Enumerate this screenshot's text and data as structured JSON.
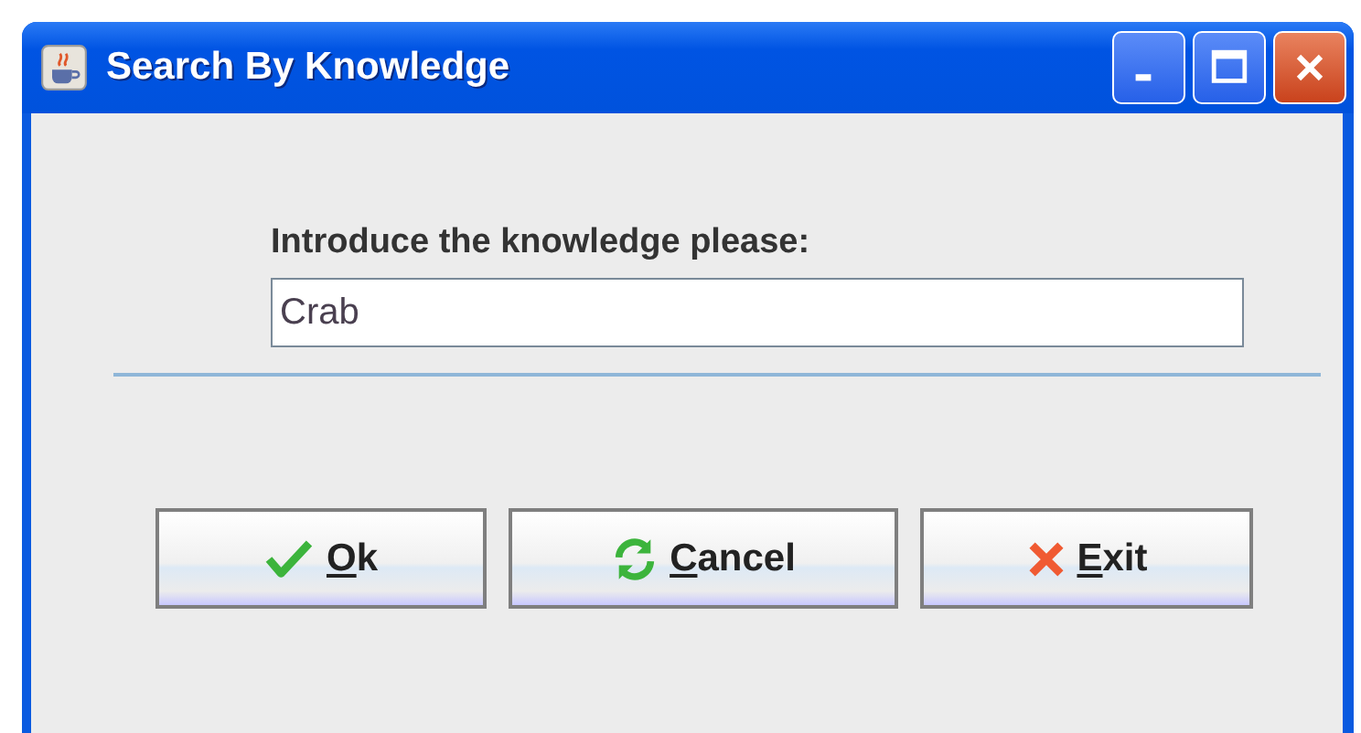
{
  "window": {
    "title": "Search By Knowledge"
  },
  "prompt": "Introduce the knowledge please:",
  "field": {
    "value": "Crab"
  },
  "buttons": [
    {
      "kind": "ok",
      "label": "Ok"
    },
    {
      "kind": "cancel",
      "label": "Cancel"
    },
    {
      "kind": "exit",
      "label": "Exit"
    }
  ]
}
